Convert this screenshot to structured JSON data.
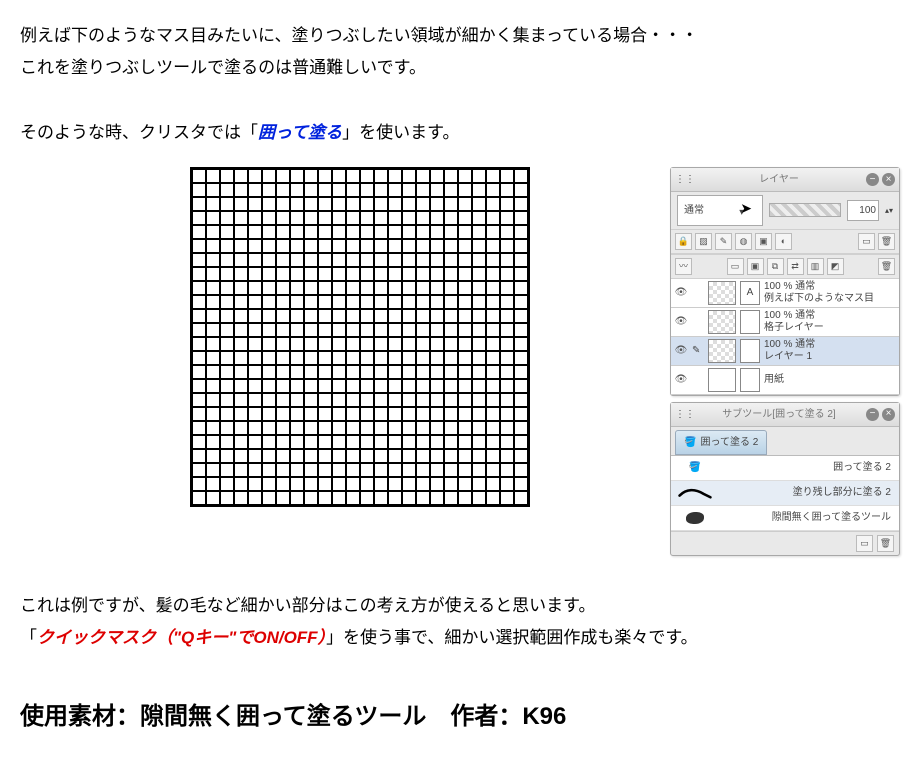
{
  "paragraphs": {
    "p1a": "例えば下のようなマス目みたいに、塗りつぶしたい領域が細かく集まっている場合・・・",
    "p1b": "これを塗りつぶしツールで塗るのは普通難しいです。",
    "p2a": "そのような時、クリスタでは「",
    "p2_highlight": "囲って塗る",
    "p2c": "」を使います。",
    "p3": "これは例ですが、髪の毛など細かい部分はこの考え方が使えると思います。",
    "p4a": "「",
    "p4_highlight": "クイックマスク（\"Qキー\"でON/OFF）",
    "p4c": "」を使う事で、細かい選択範囲作成も楽々です。"
  },
  "layer_panel": {
    "title": "レイヤー",
    "blend_mode": "通常",
    "opacity": "100",
    "layers": [
      {
        "line1": "100 % 通常",
        "line2": "例えば下のようなマス目"
      },
      {
        "line1": "100 % 通常",
        "line2": "格子レイヤー"
      },
      {
        "line1": "100 % 通常",
        "line2": "レイヤー 1"
      },
      {
        "line1": "",
        "line2": "用紙"
      }
    ]
  },
  "subtool_panel": {
    "title": "サブツール[囲って塗る 2]",
    "tab": "囲って塗る 2",
    "items": [
      "囲って塗る 2",
      "塗り残し部分に塗る 2",
      "隙間無く囲って塗るツール"
    ]
  },
  "credit": "使用素材：隙間無く囲って塗るツール　作者：K96"
}
